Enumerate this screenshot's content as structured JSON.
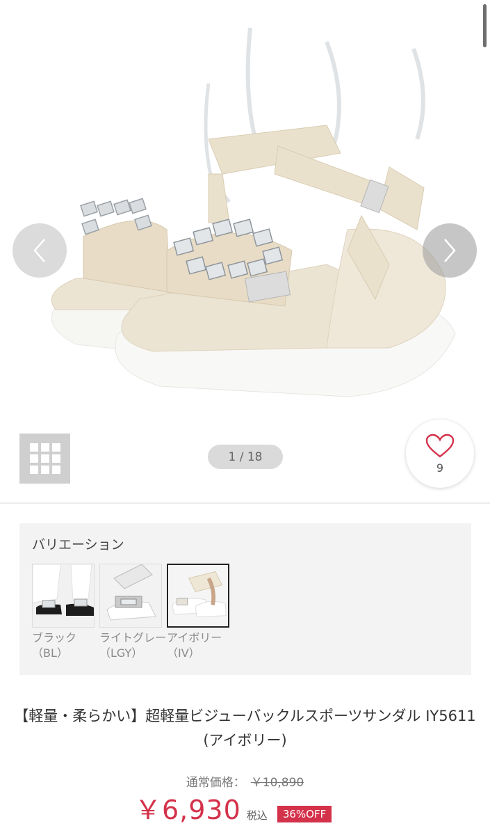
{
  "gallery": {
    "counter": "1 / 18",
    "favorite_count": "9",
    "colors": {
      "accent": "#d4314a",
      "sandal_strap": "#ece4d3",
      "sole": "#f7f7f5"
    },
    "icons": [
      "chevron-left-icon",
      "chevron-right-icon",
      "grid-icon",
      "heart-icon"
    ]
  },
  "variation": {
    "title": "バリエーション",
    "items": [
      {
        "label": "ブラック（BL）",
        "selected": false
      },
      {
        "label": "ライトグレー（LGY）",
        "selected": false
      },
      {
        "label": "アイボリー（IV）",
        "selected": true
      }
    ]
  },
  "product": {
    "title": "【軽量・柔らかい】超軽量ビジューバックルスポーツサンダル IY5611 (アイボリー)"
  },
  "price": {
    "regular_label": "通常価格：",
    "regular_value": "￥10,890",
    "sale_value": "￥6,930",
    "tax_label": "税込",
    "discount_badge": "36%OFF"
  }
}
